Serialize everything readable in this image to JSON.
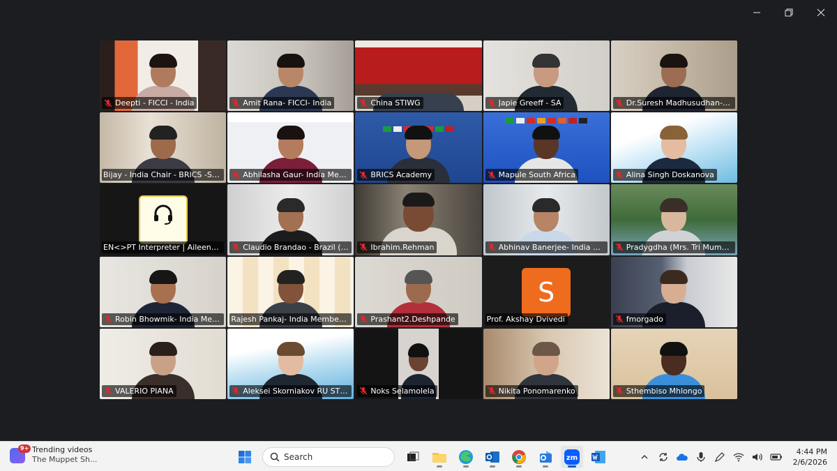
{
  "window": {
    "controls": [
      "minimize-icon",
      "restore-icon",
      "close-icon"
    ],
    "active_border_color": "#2fb86e"
  },
  "participants": [
    {
      "name": "Deepti - FICCI - India",
      "muted": true
    },
    {
      "name": "Amit Rana- FICCI- India",
      "muted": true
    },
    {
      "name": "China STIWG",
      "muted": true
    },
    {
      "name": "Japie Greeff - SA",
      "muted": true
    },
    {
      "name": "Dr.Suresh Madhusudhan- India...",
      "muted": true
    },
    {
      "name": "Bijay - India Chair - BRICS -STIWG",
      "muted": false
    },
    {
      "name": "Abhilasha Gaur- India Membe...",
      "muted": true
    },
    {
      "name": "BRICS Academy",
      "muted": true
    },
    {
      "name": "Mapule South Africa",
      "muted": true
    },
    {
      "name": "Alina Singh Doskanova",
      "muted": true
    },
    {
      "name": "EN<>PT Interpreter | Aileen Schl...",
      "muted": false
    },
    {
      "name": "Claudio Brandao - Brazil (Eme...",
      "muted": true
    },
    {
      "name": "Ibrahim.Rehman",
      "muted": true
    },
    {
      "name": "Abhinav Banerjee- India Mem...",
      "muted": true
    },
    {
      "name": "Pradygdha (Mrs. Tri Mumpuni...",
      "muted": true
    },
    {
      "name": "Robin Bhowmik- India Memb...",
      "muted": true
    },
    {
      "name": "Rajesh Pankaj- India Member - S...",
      "muted": false
    },
    {
      "name": "Prashant2.Deshpande",
      "muted": true
    },
    {
      "name": "Prof. Akshay Dvivedi",
      "muted": false,
      "active": true,
      "avatar_letter": "S"
    },
    {
      "name": "fmorgado",
      "muted": true
    },
    {
      "name": "VALERIO PIANA",
      "muted": true
    },
    {
      "name": "Aleksei Skorniakov RU STIWG",
      "muted": true
    },
    {
      "name": "Noks Selamolela",
      "muted": true
    },
    {
      "name": "Nikita Ponomarenko",
      "muted": true
    },
    {
      "name": "Sthembiso Mhlongo",
      "muted": true
    }
  ],
  "taskbar": {
    "widget": {
      "title": "Trending videos",
      "subtitle": "The Muppet Sh...",
      "badge": "9+"
    },
    "search_placeholder": "Search",
    "apps": [
      "start-icon",
      "task-view-icon",
      "file-explorer-icon",
      "edge-icon",
      "outlook-icon",
      "chrome-icon",
      "outlook-new-icon",
      "zoom-icon",
      "word-icon"
    ],
    "tray_icons": [
      "chevron-up-icon",
      "sync-icon",
      "onedrive-icon",
      "microphone-icon",
      "pen-icon",
      "wifi-icon",
      "volume-icon",
      "battery-icon"
    ],
    "time": "4:44 PM",
    "date": "2/6/2026"
  }
}
